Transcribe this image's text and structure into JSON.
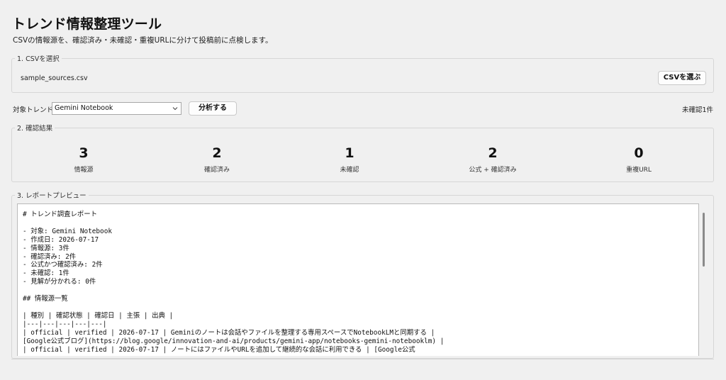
{
  "app": {
    "title": "トレンド情報整理ツール",
    "subtitle": "CSVの情報源を、確認済み・未確認・重複URLに分けて投稿前に点検します。"
  },
  "csv_section": {
    "legend": "1. CSVを選択",
    "filename": "sample_sources.csv",
    "choose_button": "CSVを選ぶ"
  },
  "controls": {
    "trend_label": "対象トレンド:",
    "trend_selected": "Gemini Notebook",
    "analyze_button": "分析する",
    "unconfirmed_status": "未確認1件"
  },
  "results": {
    "legend": "2. 確認結果",
    "stats": [
      {
        "value": "3",
        "label": "情報源"
      },
      {
        "value": "2",
        "label": "確認済み"
      },
      {
        "value": "1",
        "label": "未確認"
      },
      {
        "value": "2",
        "label": "公式 + 確認済み"
      },
      {
        "value": "0",
        "label": "重複URL"
      }
    ]
  },
  "preview": {
    "legend": "3. レポートプレビュー",
    "text": "# トレンド調査レポート\n\n- 対象: Gemini Notebook\n- 作成日: 2026-07-17\n- 情報源: 3件\n- 確認済み: 2件\n- 公式かつ確認済み: 2件\n- 未確認: 1件\n- 見解が分かれる: 0件\n\n## 情報源一覧\n\n| 種別 | 確認状態 | 確認日 | 主張 | 出典 |\n|---|---|---|---|---|\n| official | verified | 2026-07-17 | Geminiのノートは会話やファイルを整理する専用スペースでNotebookLMと同期する |\n[Google公式ブログ](https://blog.google/innovation-and-ai/products/gemini-app/notebooks-gemini-notebooklm) |\n| official | verified | 2026-07-17 | ノートにはファイルやURLを追加して継続的な会話に利用できる | [Google公式"
  }
}
